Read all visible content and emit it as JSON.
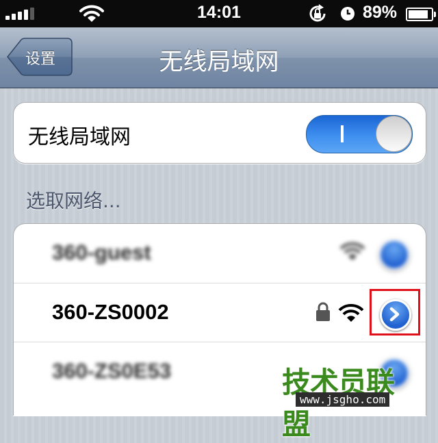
{
  "status_bar": {
    "time": "14:01",
    "battery_percent": "89%",
    "battery_level": 0.89,
    "signal_bars": 4,
    "icons": [
      "signal-icon",
      "wifi-icon",
      "rotation-lock-icon",
      "alarm-icon",
      "battery-icon"
    ]
  },
  "nav": {
    "back_label": "设置",
    "title": "无线局域网"
  },
  "wifi_toggle": {
    "label": "无线局域网",
    "state": "on"
  },
  "networks_section": {
    "header": "选取网络...",
    "networks": [
      {
        "name": "360-guest",
        "secured": false,
        "blurred": true
      },
      {
        "name": "360-ZS0002",
        "secured": true,
        "blurred": false,
        "highlighted": true
      },
      {
        "name": "360-ZS0E53",
        "secured": false,
        "blurred": true
      }
    ]
  },
  "watermark": {
    "title": "技术员联盟",
    "url": "www.jsgho.com"
  },
  "colors": {
    "accent": "#2f7fe9",
    "nav_bar": "#8a9db4",
    "highlight": "#e0101b",
    "watermark": "#3a8a1e"
  }
}
